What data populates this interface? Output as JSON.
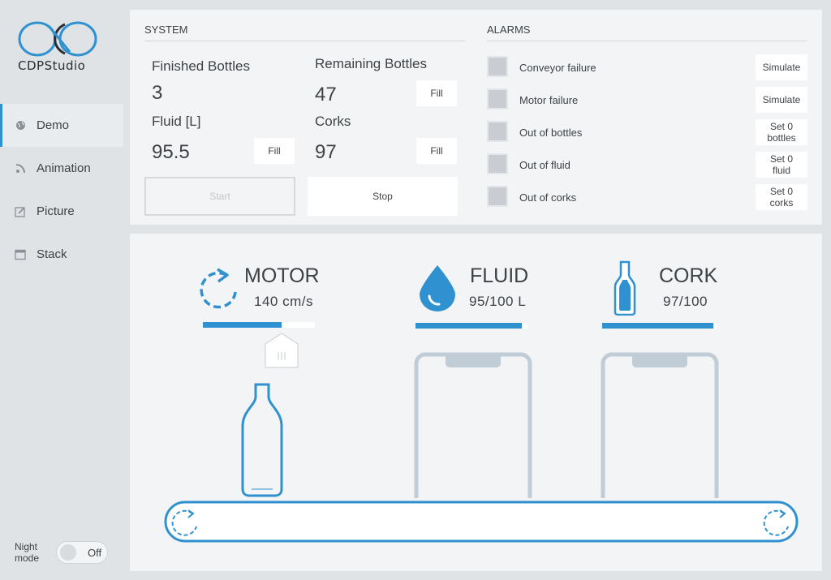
{
  "app": {
    "logo_text": "CDPStudio"
  },
  "sidebar": {
    "items": [
      {
        "label": "Demo",
        "icon": "globe-icon",
        "active": true
      },
      {
        "label": "Animation",
        "icon": "animation-icon",
        "active": false
      },
      {
        "label": "Picture",
        "icon": "edit-icon",
        "active": false
      },
      {
        "label": "Stack",
        "icon": "window-icon",
        "active": false
      }
    ],
    "night_mode": {
      "label": "Night mode",
      "state": "Off"
    }
  },
  "system": {
    "title": "SYSTEM",
    "finished_bottles": {
      "label": "Finished Bottles",
      "value": "3"
    },
    "remaining_bottles": {
      "label": "Remaining Bottles",
      "value": "47",
      "button": "Fill"
    },
    "fluid": {
      "label": "Fluid [L]",
      "value": "95.5",
      "button": "Fill"
    },
    "corks": {
      "label": "Corks",
      "value": "97",
      "button": "Fill"
    },
    "start_label": "Start",
    "stop_label": "Stop"
  },
  "alarms": {
    "title": "ALARMS",
    "items": [
      {
        "label": "Conveyor failure",
        "button": "Simulate"
      },
      {
        "label": "Motor failure",
        "button": "Simulate"
      },
      {
        "label": "Out of bottles",
        "button": "Set 0 bottles"
      },
      {
        "label": "Out of fluid",
        "button": "Set 0 fluid"
      },
      {
        "label": "Out of corks",
        "button": "Set 0 corks"
      }
    ]
  },
  "stations": {
    "motor": {
      "title": "MOTOR",
      "value": "140 cm/s",
      "progress": 0.7
    },
    "fluid": {
      "title": "FLUID",
      "value": "95/100 L",
      "progress": 0.95
    },
    "cork": {
      "title": "CORK",
      "value": "97/100",
      "progress": 0.97
    }
  },
  "colors": {
    "accent": "#2f91cf",
    "machine": "#c0ccd6",
    "panel": "#f3f4f5",
    "background": "#dfe3e6"
  }
}
